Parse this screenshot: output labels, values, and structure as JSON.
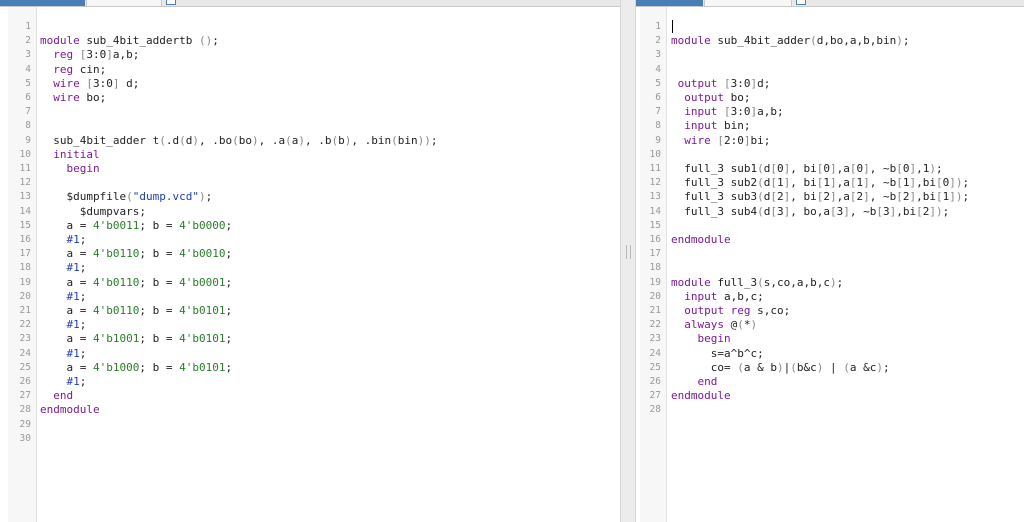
{
  "editor_left": {
    "lines": [
      "",
      "module sub_4bit_addertb ();",
      "  reg [3:0]a,b;",
      "  reg cin;",
      "  wire [3:0] d;",
      "  wire bo;",
      "",
      "",
      "  sub_4bit_adder t(.d(d), .bo(bo), .a(a), .b(b), .bin(bin));",
      "  initial",
      "    begin",
      "",
      "    $dumpfile(\"dump.vcd\");",
      "      $dumpvars;",
      "    a = 4'b0011; b = 4'b0000;",
      "    #1;",
      "    a = 4'b0110; b = 4'b0010;",
      "    #1;",
      "    a = 4'b0110; b = 4'b0001;",
      "    #1;",
      "    a = 4'b0110; b = 4'b0101;",
      "    #1;",
      "    a = 4'b1001; b = 4'b0101;",
      "    #1;",
      "    a = 4'b1000; b = 4'b0101;",
      "    #1;",
      "  end",
      "endmodule",
      "",
      ""
    ]
  },
  "editor_right": {
    "lines": [
      "",
      "module sub_4bit_adder(d,bo,a,b,bin);",
      "",
      "",
      " output [3:0]d;",
      "  output bo;",
      "  input [3:0]a,b;",
      "  input bin;",
      "  wire [2:0]bi;",
      "",
      "  full_3 sub1(d[0], bi[0],a[0], ~b[0],1);",
      "  full_3 sub2(d[1], bi[1],a[1], ~b[1],bi[0]);",
      "  full_3 sub3(d[2], bi[2],a[2], ~b[2],bi[1]);",
      "  full_3 sub4(d[3], bo,a[3], ~b[3],bi[2]);",
      "",
      "endmodule",
      "",
      "",
      "module full_3(s,co,a,b,c);",
      "  input a,b,c;",
      "  output reg s,co;",
      "  always @(*)",
      "    begin",
      "      s=a^b^c;",
      "      co= (a & b)|(b&c) | (a &c);",
      "    end",
      "endmodule",
      ""
    ]
  }
}
